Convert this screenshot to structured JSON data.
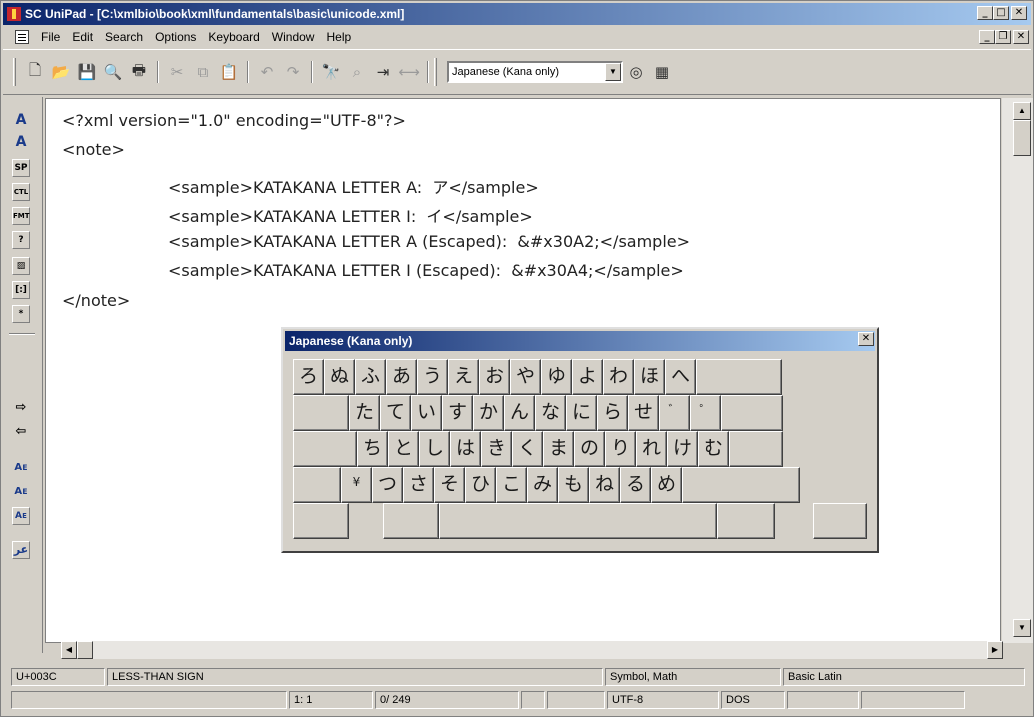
{
  "window": {
    "title": "SC UniPad - [C:\\xmlbio\\book\\xml\\fundamentals\\basic\\unicode.xml]",
    "caption_buttons": [
      "_",
      "□",
      "✕"
    ],
    "mdi_buttons": [
      "_",
      "❐",
      "✕"
    ]
  },
  "menu": {
    "items": [
      {
        "label": "File"
      },
      {
        "label": "Edit"
      },
      {
        "label": "Search"
      },
      {
        "label": "Options"
      },
      {
        "label": "Keyboard"
      },
      {
        "label": "Window"
      },
      {
        "label": "Help"
      }
    ]
  },
  "toolbar": {
    "icons": {
      "new": "🗋",
      "open": "📂",
      "save": "💾",
      "print_preview": "🔍",
      "print": "🖶",
      "cut": "✂",
      "copy": "⧉",
      "paste": "📋",
      "undo": "↶",
      "redo": "↷",
      "find": "🔭",
      "find_next": "⌕",
      "goto": "⇥",
      "match": "⟷",
      "keyboard_icon": "◎",
      "table_icon": "▦"
    },
    "keyboard_select": "Japanese (Kana only)"
  },
  "leftbar": {
    "labels": {
      "b1": "A",
      "b2": "A",
      "b3": "SP",
      "b4": "CTL",
      "b5": "FMT",
      "b6": "?",
      "b7": "▨",
      "b8": "[:]",
      "b9": "*",
      "b10": "⇨",
      "b11": "⇦",
      "b12": "Aᴇ",
      "b13": "Aᴇ",
      "b14": "Aᴇ",
      "b15": "عر"
    }
  },
  "editor": {
    "lines": [
      "<?xml version=\"1.0\" encoding=\"UTF-8\"?>",
      "<note>",
      "<sample>KATAKANA LETTER A:  ア</sample>",
      "<sample>KATAKANA LETTER I:  イ</sample>",
      "<sample>KATAKANA LETTER A (Escaped):  &#x30A2;</sample>",
      "<sample>KATAKANA LETTER I (Escaped):  &#x30A4;</sample>",
      "</note>"
    ]
  },
  "keyboard": {
    "title": "Japanese (Kana only)",
    "close": "✕",
    "row1": [
      "ろ",
      "ぬ",
      "ふ",
      "あ",
      "う",
      "え",
      "お",
      "や",
      "ゆ",
      "よ",
      "わ",
      "ほ",
      "へ"
    ],
    "row2": [
      "た",
      "て",
      "い",
      "す",
      "か",
      "ん",
      "な",
      "に",
      "ら",
      "せ",
      "゛",
      "゜"
    ],
    "row3": [
      "ち",
      "と",
      "し",
      "は",
      "き",
      "く",
      "ま",
      "の",
      "り",
      "れ",
      "け",
      "む"
    ],
    "row4": [
      "¥",
      "つ",
      "さ",
      "そ",
      "ひ",
      "こ",
      "み",
      "も",
      "ね",
      "る",
      "め"
    ]
  },
  "status": {
    "row1": [
      "U+003C",
      "LESS-THAN SIGN",
      "Symbol, Math",
      "Basic Latin"
    ],
    "row2": [
      "1: 1",
      "0/ 249",
      "UTF-8",
      "DOS"
    ]
  },
  "scroll": {
    "up": "▲",
    "down": "▼",
    "left": "◀",
    "right": "▶"
  }
}
